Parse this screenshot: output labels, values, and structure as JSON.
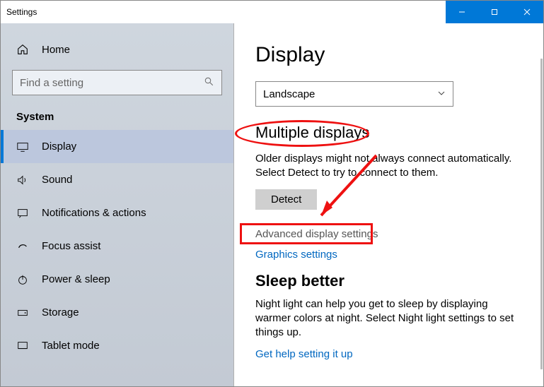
{
  "window_title": "Settings",
  "home_label": "Home",
  "search_placeholder": "Find a setting",
  "section_label": "System",
  "nav": [
    {
      "label": "Display"
    },
    {
      "label": "Sound"
    },
    {
      "label": "Notifications & actions"
    },
    {
      "label": "Focus assist"
    },
    {
      "label": "Power & sleep"
    },
    {
      "label": "Storage"
    },
    {
      "label": "Tablet mode"
    }
  ],
  "main": {
    "title": "Display",
    "orientation_value": "Landscape",
    "section_multiple": "Multiple displays",
    "multiple_body": "Older displays might not always connect automatically. Select Detect to try to connect to them.",
    "detect_label": "Detect",
    "advanced_link": "Advanced display settings",
    "graphics_link": "Graphics settings",
    "sleep_heading": "Sleep better",
    "sleep_body": "Night light can help you get to sleep by displaying warmer colors at night. Select Night light settings to set things up.",
    "sleep_link": "Get help setting it up"
  }
}
